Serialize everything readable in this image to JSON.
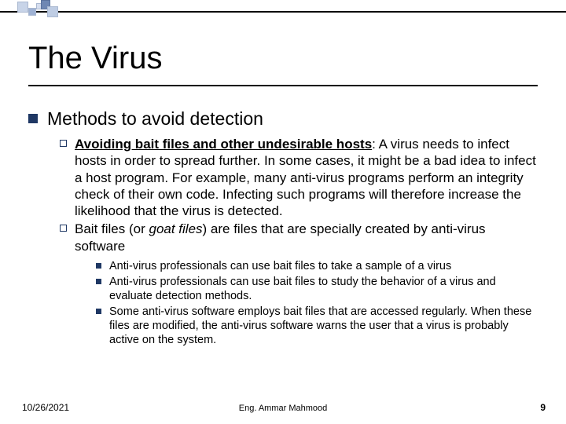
{
  "title": "The Virus",
  "level1": {
    "text": "Methods to avoid detection"
  },
  "level2": [
    {
      "bold_underline": "Avoiding bait files and other undesirable hosts",
      "rest": ": A virus needs to infect hosts in order to spread further. In some cases, it might be a bad idea to infect a host program. For example, many anti-virus programs perform an integrity check of their own code. Infecting such programs will therefore increase the likelihood that the virus is detected."
    },
    {
      "pre": "Bait files (or ",
      "italic": "goat files",
      "post": ") are files that are specially created by anti-virus software"
    }
  ],
  "level3": [
    "Anti-virus professionals can use bait files to take a sample of a virus",
    "Anti-virus professionals can use bait files to study the behavior of a virus and evaluate detection methods.",
    "Some anti-virus software employs bait files that are accessed regularly. When these files are modified, the anti-virus software warns the user that a virus is probably active on the system."
  ],
  "footer": {
    "date": "10/26/2021",
    "center": "Eng. Ammar Mahmood",
    "page": "9"
  }
}
